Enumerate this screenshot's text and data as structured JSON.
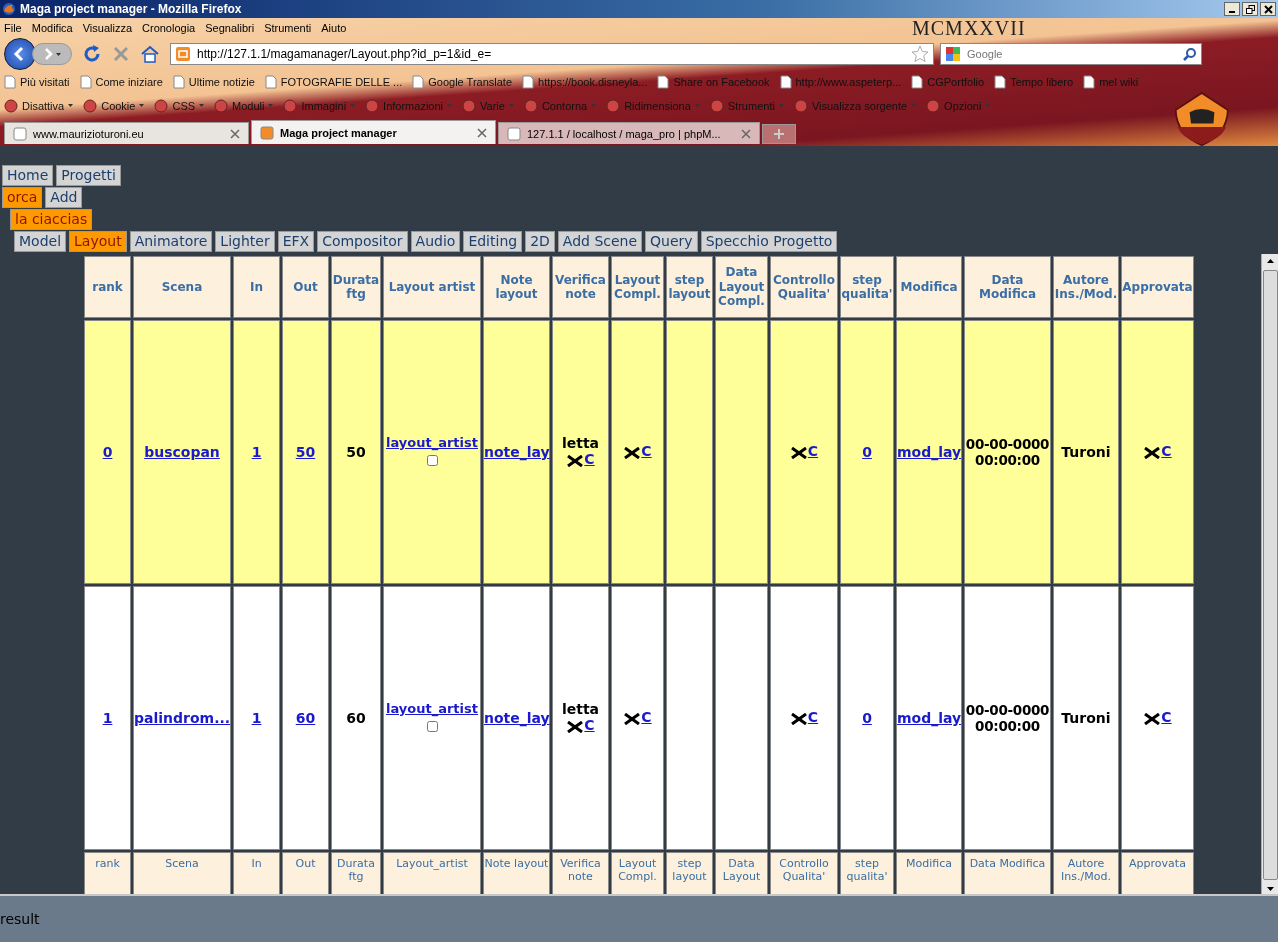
{
  "window": {
    "title": "Maga project manager - Mozilla Firefox"
  },
  "menu": [
    "File",
    "Modifica",
    "Visualizza",
    "Cronologia",
    "Segnalibri",
    "Strumenti",
    "Aiuto"
  ],
  "address_bar": {
    "value": "http://127.1.1/magamanager/Layout.php?id_p=1&id_e="
  },
  "search": {
    "placeholder": "Google"
  },
  "theme_title": "MCMXXVII",
  "bookmarks": [
    "Più visitati",
    "Come iniziare",
    "Ultime notizie",
    "FOTOGRAFIE DELLE ...",
    "Google Translate",
    "https://book.disneyla...",
    "Share on Facebook",
    "http://www.aspeterp...",
    "CGPortfolio",
    "Tempo libero",
    "mel wiki"
  ],
  "devtools": [
    "Disattiva",
    "Cookie",
    "CSS",
    "Moduli",
    "Immagini",
    "Informazioni",
    "Varie",
    "Contorna",
    "Ridimensiona",
    "Strumenti",
    "Visualizza sorgente",
    "Opzioni"
  ],
  "tabs": [
    {
      "label": "www.maurizioturoni.eu",
      "selected": false
    },
    {
      "label": "Maga project manager",
      "selected": true
    },
    {
      "label": "127.1.1 / localhost / maga_pro | phpM...",
      "selected": false
    }
  ],
  "nav_levels": [
    [
      {
        "label": "Home",
        "selected": false
      },
      {
        "label": "Progetti",
        "selected": false
      }
    ],
    [
      {
        "label": "orca",
        "selected": true
      },
      {
        "label": "Add",
        "selected": false
      }
    ],
    [
      {
        "label": "la ciaccias",
        "selected": true
      }
    ],
    [
      {
        "label": "Model",
        "selected": false
      },
      {
        "label": "Layout",
        "selected": true
      },
      {
        "label": "Animatore",
        "selected": false
      },
      {
        "label": "Lighter",
        "selected": false
      },
      {
        "label": "EFX",
        "selected": false
      },
      {
        "label": "Compositor",
        "selected": false
      },
      {
        "label": "Audio",
        "selected": false
      },
      {
        "label": "Editing",
        "selected": false
      },
      {
        "label": "2D",
        "selected": false
      },
      {
        "label": "Add Scene",
        "selected": false
      },
      {
        "label": "Query",
        "selected": false
      },
      {
        "label": "Specchio Progetto",
        "selected": false
      }
    ]
  ],
  "table": {
    "columns": [
      "rank",
      "Scena",
      "In",
      "Out",
      "Durata ftg",
      "Layout artist",
      "Note layout",
      "Verifica note",
      "Layout Compl.",
      "step layout",
      "Data Layout Compl.",
      "Controllo Qualita'",
      "step qualita'",
      "Modifica",
      "Data Modifica",
      "Autore Ins./Mod.",
      "Approvata"
    ],
    "rows": [
      {
        "selected": true,
        "rank": "0",
        "scena": "buscopan",
        "in": "1",
        "out": "50",
        "durata": "50",
        "layout_artist": "layout_artist",
        "artist_checked": false,
        "note": "note_lay",
        "verifica_text": "letta",
        "verifica_link": "C",
        "layout_compl_link": "C",
        "controllo_link": "C",
        "step_qualita": "0",
        "modifica": "mod_lay",
        "data_modifica": [
          "00-00-0000",
          "00:00:00"
        ],
        "autore": "Turoni",
        "approvata_link": "C"
      },
      {
        "selected": false,
        "rank": "1",
        "scena": "palindrom...",
        "in": "1",
        "out": "60",
        "durata": "60",
        "layout_artist": "layout_artist",
        "artist_checked": false,
        "note": "note_lay",
        "verifica_text": "letta",
        "verifica_link": "C",
        "layout_compl_link": "C",
        "controllo_link": "C",
        "step_qualita": "0",
        "modifica": "mod_lay",
        "data_modifica": [
          "00-00-0000",
          "00:00:00"
        ],
        "autore": "Turoni",
        "approvata_link": "C"
      }
    ],
    "footer_columns": [
      "rank",
      "Scena",
      "In",
      "Out",
      "Durata ftg",
      "Layout_artist",
      "Note layout",
      "Verifica note",
      "Layout Compl.",
      "step layout",
      "Data Layout",
      "Controllo Qualita'",
      "step qualita'",
      "Modifica",
      "Data Modifica",
      "Autore Ins./Mod.",
      "Approvata"
    ]
  },
  "status_bar": {
    "text": "result"
  }
}
